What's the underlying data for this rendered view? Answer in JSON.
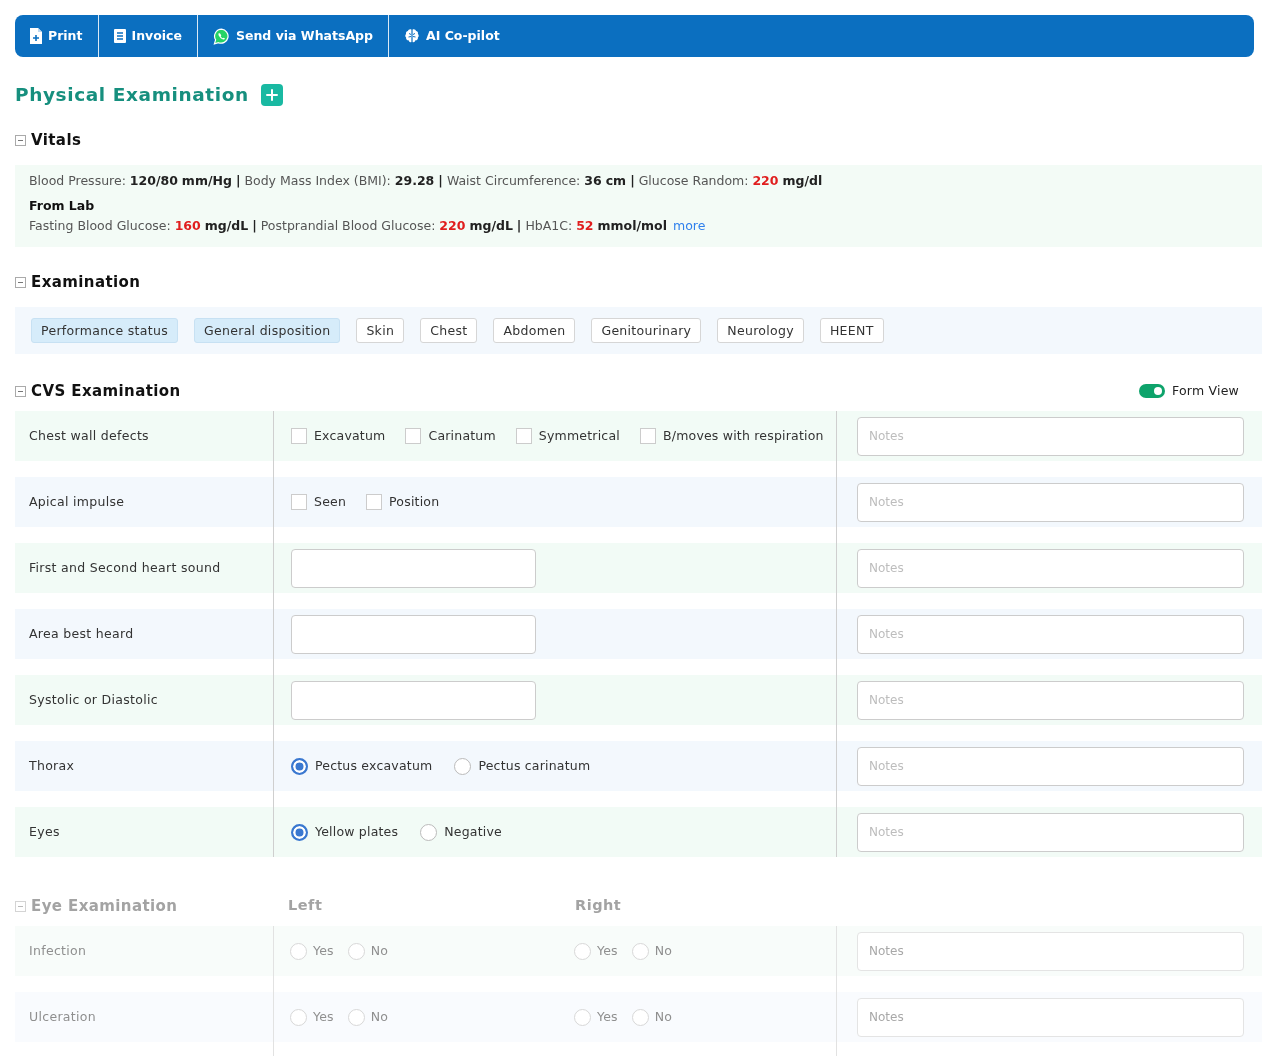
{
  "toolbar": [
    {
      "kind": "print",
      "label": "Print"
    },
    {
      "kind": "invoice",
      "label": "Invoice"
    },
    {
      "kind": "whatsapp",
      "label": "Send via WhatsApp"
    },
    {
      "kind": "copilot",
      "label": "AI Co-pilot"
    }
  ],
  "page_title": "Physical Examination",
  "vitals": {
    "title": "Vitals",
    "expanded": true,
    "separator": "|",
    "items": [
      {
        "label": "Blood Pressure:",
        "value": "120/80",
        "unit": "mm/Hg",
        "abnormal": false
      },
      {
        "label": "Body Mass Index (BMI):",
        "value": "29.28",
        "abnormal": false
      },
      {
        "label": "Waist Circumference:",
        "value": "36",
        "unit": "cm",
        "abnormal": false
      },
      {
        "label": "Glucose Random:",
        "value": "220",
        "unit": "mg/dl",
        "abnormal": true
      }
    ],
    "lab_title": "From Lab",
    "lab_items": [
      {
        "label": "Fasting Blood Glucose:",
        "value": "160",
        "unit": "mg/dL",
        "abnormal": true
      },
      {
        "label": "Postprandial Blood Glucose:",
        "value": "220",
        "unit": "mg/dL",
        "abnormal": true
      },
      {
        "label": "HbA1C:",
        "value": "52",
        "unit": "mmol/mol",
        "abnormal": true
      }
    ],
    "more_link": "more"
  },
  "examination": {
    "title": "Examination",
    "expanded": true,
    "tabs": [
      {
        "label": "Performance status",
        "selected": true
      },
      {
        "label": "General disposition",
        "selected": true
      },
      {
        "label": "Skin",
        "selected": false
      },
      {
        "label": "Chest",
        "selected": false
      },
      {
        "label": "Abdomen",
        "selected": false
      },
      {
        "label": "Genitourinary",
        "selected": false
      },
      {
        "label": "Neurology",
        "selected": false
      },
      {
        "label": "HEENT",
        "selected": false
      }
    ]
  },
  "cvs": {
    "title": "CVS Examination",
    "expanded": true,
    "form_view": {
      "label": "Form View",
      "on": true
    },
    "rows": [
      {
        "label": "Chest wall defects",
        "kind": "checkboxes",
        "options": [
          {
            "label": "Excavatum",
            "checked": false
          },
          {
            "label": "Carinatum",
            "checked": false
          },
          {
            "label": "Symmetrical",
            "checked": false
          },
          {
            "label": "B/moves with respiration",
            "checked": false
          }
        ],
        "notes": {
          "placeholder": "Notes"
        }
      },
      {
        "label": "Apical impulse",
        "kind": "checkboxes",
        "options": [
          {
            "label": "Seen",
            "checked": false
          },
          {
            "label": "Position",
            "checked": false
          }
        ],
        "notes": {
          "placeholder": "Notes"
        }
      },
      {
        "label": "First and Second heart sound",
        "kind": "text",
        "notes": {
          "placeholder": "Notes"
        }
      },
      {
        "label": "Area best heard",
        "kind": "text",
        "notes": {
          "placeholder": "Notes"
        }
      },
      {
        "label": "Systolic or Diastolic",
        "kind": "text",
        "notes": {
          "placeholder": "Notes"
        }
      },
      {
        "label": "Thorax",
        "kind": "radios",
        "options": [
          {
            "label": "Pectus excavatum",
            "selected": true
          },
          {
            "label": "Pectus carinatum",
            "selected": false
          }
        ],
        "notes": {
          "placeholder": "Notes"
        }
      },
      {
        "label": "Eyes",
        "kind": "radios",
        "options": [
          {
            "label": "Yellow plates",
            "selected": true
          },
          {
            "label": "Negative",
            "selected": false
          }
        ],
        "notes": {
          "placeholder": "Notes"
        }
      }
    ]
  },
  "eye": {
    "title": "Eye Examination",
    "expanded": true,
    "disabled": true,
    "columns": [
      "Left",
      "Right"
    ],
    "rows": [
      {
        "label": "Infection",
        "left": [
          {
            "label": "Yes",
            "selected": false
          },
          {
            "label": "No",
            "selected": false
          }
        ],
        "right": [
          {
            "label": "Yes",
            "selected": false
          },
          {
            "label": "No",
            "selected": false
          }
        ],
        "notes": {
          "placeholder": "Notes"
        }
      },
      {
        "label": "Ulceration",
        "left": [
          {
            "label": "Yes",
            "selected": false
          },
          {
            "label": "No",
            "selected": false
          }
        ],
        "right": [
          {
            "label": "Yes",
            "selected": false
          },
          {
            "label": "No",
            "selected": false
          }
        ],
        "notes": {
          "placeholder": "Notes"
        }
      }
    ]
  }
}
